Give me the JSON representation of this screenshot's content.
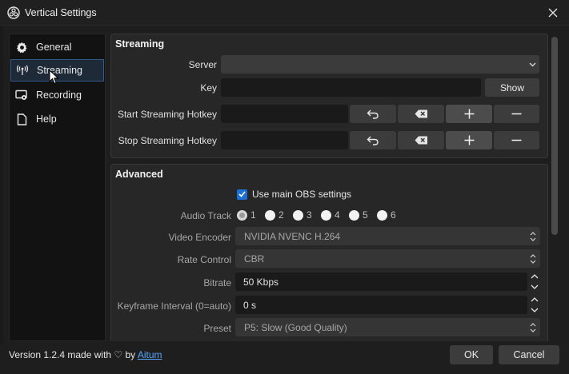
{
  "window": {
    "title": "Vertical Settings"
  },
  "sidebar": {
    "items": [
      {
        "label": "General",
        "icon": "gear-icon"
      },
      {
        "label": "Streaming",
        "icon": "antenna-icon"
      },
      {
        "label": "Recording",
        "icon": "recording-icon"
      },
      {
        "label": "Help",
        "icon": "document-icon"
      }
    ],
    "active_index": 1
  },
  "streaming": {
    "title": "Streaming",
    "server_label": "Server",
    "server_value": "",
    "key_label": "Key",
    "key_value": "",
    "show_button": "Show",
    "start_hotkey_label": "Start Streaming Hotkey",
    "stop_hotkey_label": "Stop Streaming Hotkey"
  },
  "advanced": {
    "title": "Advanced",
    "use_main_label": "Use main OBS settings",
    "use_main_checked": true,
    "audio_track_label": "Audio Track",
    "audio_tracks": [
      "1",
      "2",
      "3",
      "4",
      "5",
      "6"
    ],
    "audio_track_selected": 0,
    "video_encoder_label": "Video Encoder",
    "video_encoder_value": "NVIDIA NVENC H.264",
    "rate_control_label": "Rate Control",
    "rate_control_value": "CBR",
    "bitrate_label": "Bitrate",
    "bitrate_value": "50 Kbps",
    "keyframe_label": "Keyframe Interval (0=auto)",
    "keyframe_value": "0 s",
    "preset_label": "Preset",
    "preset_value": "P5: Slow (Good Quality)"
  },
  "footer": {
    "version_text": "Version 1.2.4 made with ♡ by ",
    "link_text": "Aitum",
    "ok_button": "OK",
    "cancel_button": "Cancel"
  },
  "colors": {
    "accent": "#1c6fd3",
    "link": "#58a6ff",
    "active_border": "#315a8c"
  }
}
